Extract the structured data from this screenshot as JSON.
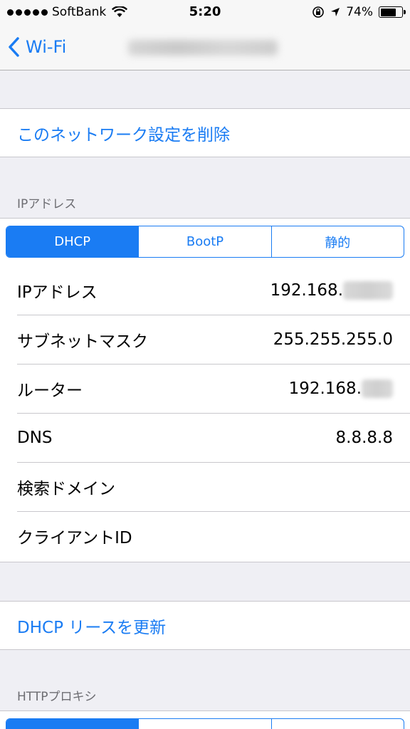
{
  "status_bar": {
    "carrier": "SoftBank",
    "time": "5:20",
    "battery": "74%",
    "battery_level": 0.74,
    "icons": [
      "signal-dots",
      "wifi-icon",
      "rotation-lock-icon",
      "location-arrow-icon",
      "battery-icon"
    ]
  },
  "nav": {
    "back_label": "Wi-Fi"
  },
  "forget_network": "このネットワーク設定を削除",
  "ip_section": {
    "header": "IPアドレス",
    "segments": [
      "DHCP",
      "BootP",
      "静的"
    ],
    "selected_segment": 0,
    "rows": [
      {
        "label": "IPアドレス",
        "value": "192.168."
      },
      {
        "label": "サブネットマスク",
        "value": "255.255.255.0"
      },
      {
        "label": "ルーター",
        "value": "192.168."
      },
      {
        "label": "DNS",
        "value": "8.8.8.8"
      },
      {
        "label": "検索ドメイン",
        "value": ""
      },
      {
        "label": "クライアントID",
        "value": ""
      }
    ]
  },
  "renew_lease": "DHCP リースを更新",
  "proxy_section": {
    "header": "HTTPプロキシ"
  },
  "colors": {
    "accent": "#1a7cf3",
    "background": "#efeff4",
    "separator": "#c8c7cc",
    "section_text": "#6d6d72"
  }
}
